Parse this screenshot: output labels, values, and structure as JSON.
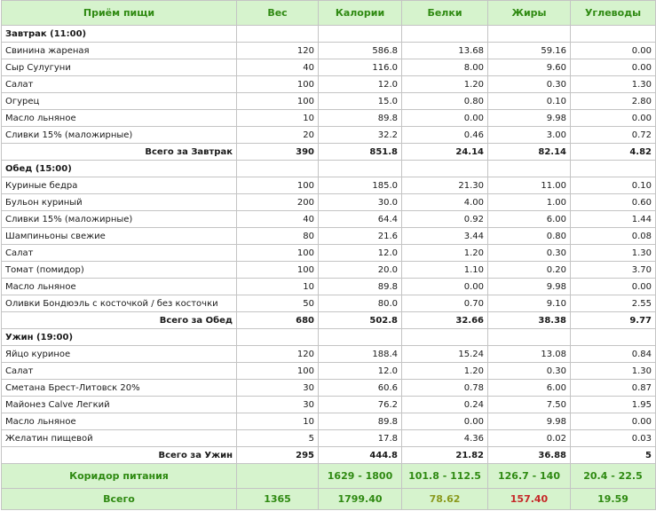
{
  "headers": [
    "Приём пищи",
    "Вес",
    "Калории",
    "Белки",
    "Жиры",
    "Углеводы"
  ],
  "meals": [
    {
      "title": "Завтрак (11:00)",
      "items": [
        [
          "Свинина жареная",
          "120",
          "586.8",
          "13.68",
          "59.16",
          "0.00"
        ],
        [
          "Сыр Сулугуни",
          "40",
          "116.0",
          "8.00",
          "9.60",
          "0.00"
        ],
        [
          "Салат",
          "100",
          "12.0",
          "1.20",
          "0.30",
          "1.30"
        ],
        [
          "Огурец",
          "100",
          "15.0",
          "0.80",
          "0.10",
          "2.80"
        ],
        [
          "Масло льняное",
          "10",
          "89.8",
          "0.00",
          "9.98",
          "0.00"
        ],
        [
          "Сливки 15% (маложирные)",
          "20",
          "32.2",
          "0.46",
          "3.00",
          "0.72"
        ]
      ],
      "total": [
        "Всего за Завтрак",
        "390",
        "851.8",
        "24.14",
        "82.14",
        "4.82"
      ]
    },
    {
      "title": "Обед (15:00)",
      "items": [
        [
          "Куриные бедра",
          "100",
          "185.0",
          "21.30",
          "11.00",
          "0.10"
        ],
        [
          "Бульон куриный",
          "200",
          "30.0",
          "4.00",
          "1.00",
          "0.60"
        ],
        [
          "Сливки 15% (маложирные)",
          "40",
          "64.4",
          "0.92",
          "6.00",
          "1.44"
        ],
        [
          "Шампиньоны свежие",
          "80",
          "21.6",
          "3.44",
          "0.80",
          "0.08"
        ],
        [
          "Салат",
          "100",
          "12.0",
          "1.20",
          "0.30",
          "1.30"
        ],
        [
          "Томат (помидор)",
          "100",
          "20.0",
          "1.10",
          "0.20",
          "3.70"
        ],
        [
          "Масло льняное",
          "10",
          "89.8",
          "0.00",
          "9.98",
          "0.00"
        ],
        [
          "Оливки Бондюэль с косточкой / без косточки",
          "50",
          "80.0",
          "0.70",
          "9.10",
          "2.55"
        ]
      ],
      "total": [
        "Всего за Обед",
        "680",
        "502.8",
        "32.66",
        "38.38",
        "9.77"
      ]
    },
    {
      "title": "Ужин (19:00)",
      "items": [
        [
          "Яйцо куриное",
          "120",
          "188.4",
          "15.24",
          "13.08",
          "0.84"
        ],
        [
          "Салат",
          "100",
          "12.0",
          "1.20",
          "0.30",
          "1.30"
        ],
        [
          "Сметана Брест-Литовск 20%",
          "30",
          "60.6",
          "0.78",
          "6.00",
          "0.87"
        ],
        [
          "Майонез Calve Легкий",
          "30",
          "76.2",
          "0.24",
          "7.50",
          "1.95"
        ],
        [
          "Масло льняное",
          "10",
          "89.8",
          "0.00",
          "9.98",
          "0.00"
        ],
        [
          "Желатин пищевой",
          "5",
          "17.8",
          "4.36",
          "0.02",
          "0.03"
        ]
      ],
      "total": [
        "Всего за Ужин",
        "295",
        "444.8",
        "21.82",
        "36.88",
        "5"
      ]
    }
  ],
  "corridor": [
    "Коридор питания",
    "",
    "1629 - 1800",
    "101.8 - 112.5",
    "126.7 - 140",
    "20.4 - 22.5"
  ],
  "grand_total": [
    "Всего",
    "1365",
    "1799.40",
    "78.62",
    "157.40",
    "19.59"
  ],
  "colors": {
    "header_bg": "#d6f3cd",
    "header_text": "#2f8a12",
    "protein_total": "#8a9a1e",
    "fat_total": "#c62828",
    "border": "#c4c4c4"
  }
}
